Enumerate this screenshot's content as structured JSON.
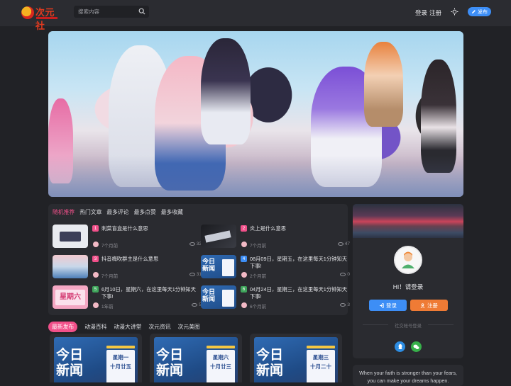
{
  "header": {
    "logo_text": "次元社",
    "search": {
      "placeholder": "搜索内容"
    },
    "login_label": "登录",
    "register_label": "注册",
    "publish_label": "发布"
  },
  "colors": {
    "accent_pink": "#f1508a",
    "primary_blue": "#3d8ef6",
    "orange": "#ef7b35",
    "background": "#212226",
    "card": "#2a2b30"
  },
  "posts": {
    "tabs": [
      "随机推荐",
      "热门文章",
      "最多评论",
      "最多点赞",
      "最多收藏"
    ],
    "items": [
      {
        "rank": "1",
        "rank_color": "#f1508a",
        "title": "刺菜盲盒是什么意思",
        "time": "7个月前",
        "views": "32",
        "thumb": "card"
      },
      {
        "rank": "2",
        "rank_color": "#f1508a",
        "title": "炎上是什么意思",
        "time": "7个月前",
        "views": "47",
        "thumb": "dark"
      },
      {
        "rank": "3",
        "rank_color": "#f1508a",
        "title": "抖音梅吹群主是什么意思",
        "time": "7个月前",
        "views": "31",
        "thumb": "sea"
      },
      {
        "rank": "4",
        "rank_color": "#3d8ef6",
        "title": "08月09日，星期五，在这里每天1分钟知天下事!",
        "time": "2个月前",
        "views": "0",
        "thumb": "news"
      },
      {
        "rank": "5",
        "rank_color": "#3fa55b",
        "title": "6月10日，星期六，在这里每天1分钟知天下事!",
        "time": "1年前",
        "views": "5",
        "thumb": "pink"
      },
      {
        "rank": "6",
        "rank_color": "#3fa55b",
        "title": "04月24日，星期三，在这里每天1分钟知天下事!",
        "time": "6个月前",
        "views": "3",
        "thumb": "news"
      }
    ]
  },
  "categories": {
    "tabs": [
      "最新发布",
      "动漫百科",
      "动漫大讲堂",
      "次元资讯",
      "次元美图"
    ]
  },
  "news_cards": [
    {
      "big": "今日新闻",
      "day": "星期一",
      "date": "十月廿五"
    },
    {
      "big": "今日新闻",
      "day": "星期六",
      "date": "十月廿三"
    },
    {
      "big": "今日新闻",
      "day": "星期三",
      "date": "十月二十"
    }
  ],
  "login": {
    "greeting": "HI！请登录",
    "login_button": "登录",
    "register_button": "注册",
    "social_label": "社交帐号登录"
  },
  "quote": {
    "line1": "When your faith is stronger than your fears,",
    "line2": "you can make your dreams happen."
  }
}
